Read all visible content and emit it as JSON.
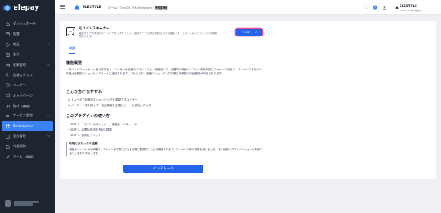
{
  "brand": {
    "logo_text": "elepay"
  },
  "sidebar": {
    "items": [
      {
        "label": "ダッシュボード",
        "icon": "home-icon",
        "chevron": false,
        "badge": ""
      },
      {
        "label": "店舗",
        "icon": "store-icon",
        "chevron": false,
        "badge": ""
      },
      {
        "label": "商品",
        "icon": "tag-icon",
        "chevron": true,
        "badge": ""
      },
      {
        "label": "注文",
        "icon": "order-icon",
        "chevron": false,
        "badge": ""
      },
      {
        "label": "在庫管理",
        "icon": "box-icon",
        "chevron": true,
        "badge": ""
      },
      {
        "label": "店舗スタッフ",
        "icon": "users-icon",
        "chevron": false,
        "badge": ""
      },
      {
        "label": "クーポン",
        "icon": "coupon-icon",
        "chevron": false,
        "badge": ""
      },
      {
        "label": "キャンペーン",
        "icon": "megaphone-icon",
        "chevron": false,
        "badge": ""
      },
      {
        "label": "統計",
        "icon": "chart-icon",
        "chevron": false,
        "badge": "Beta"
      },
      {
        "label": "サービス設定",
        "icon": "settings-icon",
        "chevron": true,
        "badge": ""
      },
      {
        "label": "Marketplace",
        "icon": "grid-icon",
        "chevron": false,
        "badge": "",
        "active": true
      },
      {
        "label": "契約管理",
        "icon": "contract-icon",
        "chevron": true,
        "badge": ""
      },
      {
        "label": "利用規約",
        "icon": "doc-icon",
        "chevron": false,
        "badge": ""
      },
      {
        "label": "ツール",
        "icon": "tool-icon",
        "chevron": false,
        "badge": "Beta"
      }
    ]
  },
  "topbar": {
    "shop_name": "ELESTYLE",
    "breadcrumb": [
      "ホーム",
      "OneQR",
      "Marketplace"
    ],
    "breadcrumb_current": "機能詳細",
    "user_name": "ELESTYLE",
    "user_sub": "ELESTYLE株式会社..."
  },
  "app": {
    "title": "モバイルスキャナー",
    "description": "機能ガイドや商品のバーコードをスキャンして、接続カートに商品を追加できる機能です。スムーズなショッピング体験を提供します。",
    "install_label": "インストール",
    "tab_label": "概要"
  },
  "overview": {
    "heading": "機能概要",
    "body": "「モバイルスキャナー」を利用すると、ユーザーは自身のスマートフォンを使用して、店舗内の商品バーコードを効率的にスキャンできます。スキャンするだけで、商品は自動的にショッピングカートに追加されます。これにより、迅速なショッピング体験と効率的な商品選択が可能となります。"
  },
  "recommend": {
    "heading": "こんな方におすすめ",
    "items": [
      "☑ スムーズで効率的なショッピングを希望するユーザー",
      "☑ バーコードを利用して、商品情報を正確にカートに追加したい方"
    ]
  },
  "howto": {
    "heading": "このプラグインの使い方",
    "steps": [
      "• STEP 1. 「モバイルスキャナー」機能をインストール",
      "• STEP 2. 必要な設定を適切に調整",
      "• STEP 3. 保存をクリック"
    ]
  },
  "note": {
    "title": "利用にあたっての注意",
    "body": "商品のバーコードは明瞭で、スキャンが容易に行える位置に配置することが推奨されます。スキャンの際の認識を避けるため、常に最新のアプリバージョンを利用することをおすすめします。"
  },
  "footer": {
    "install_label": "インストール"
  },
  "colors": {
    "sidebar_bg": "#1d2530",
    "accent": "#2563eb",
    "highlight": "#ec4899"
  }
}
